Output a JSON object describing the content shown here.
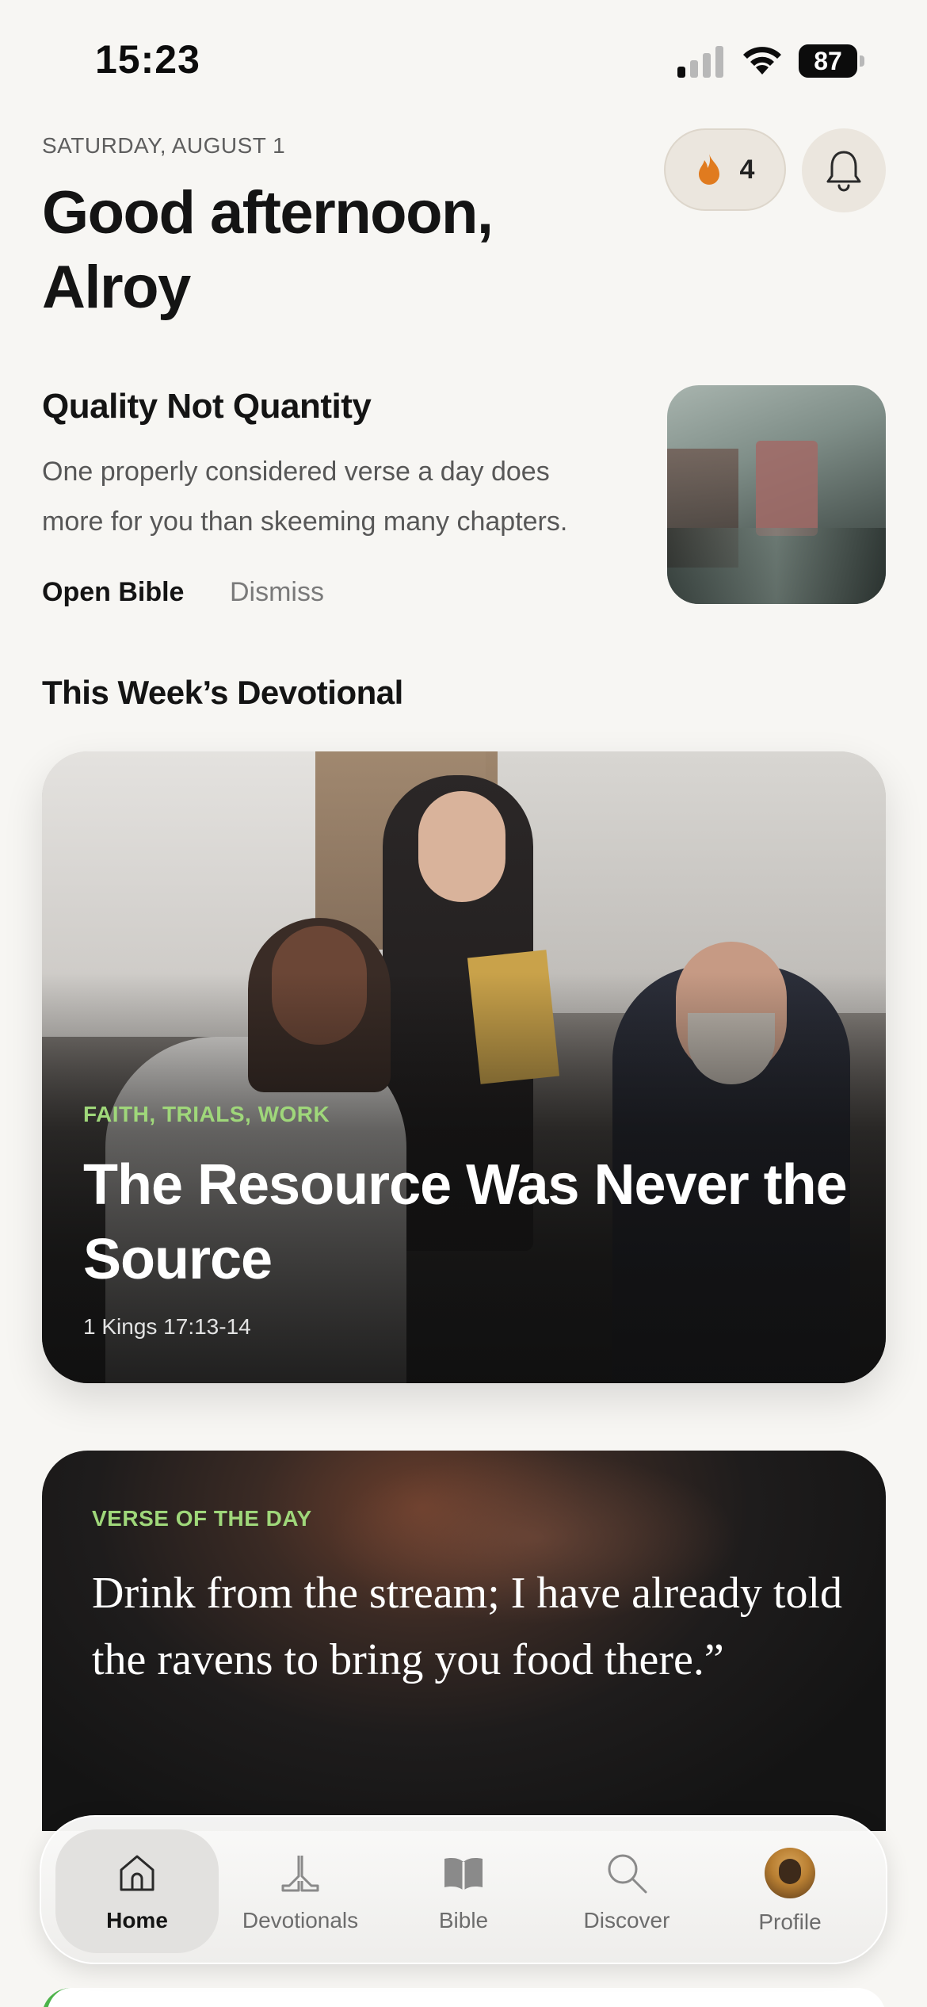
{
  "status_bar": {
    "time": "15:23",
    "battery": "87"
  },
  "header": {
    "date": "SATURDAY, AUGUST 1",
    "greeting": "Good afternoon, Alroy",
    "streak_count": "4",
    "streak_icon": "flame-icon",
    "notification_icon": "bell-icon"
  },
  "tip": {
    "title": "Quality Not Quantity",
    "body": "One properly considered verse a day does more for you than skeeming many chapters.",
    "open_label": "Open Bible",
    "dismiss_label": "Dismiss"
  },
  "devotional_section": {
    "title": "This Week’s Devotional",
    "card": {
      "tags": "FAITH, TRIALS, WORK",
      "title": "The Resource Was Never the Source",
      "reference": "1 Kings 17:13-14"
    }
  },
  "verse_of_day": {
    "label": "VERSE OF THE DAY",
    "text": "Drink from the stream; I have already told the ravens to bring you food there.”"
  },
  "tabbar": {
    "tabs": [
      {
        "label": "Home",
        "icon": "home-icon",
        "active": true
      },
      {
        "label": "Devotionals",
        "icon": "praying-hands-icon",
        "active": false
      },
      {
        "label": "Bible",
        "icon": "book-icon",
        "active": false
      },
      {
        "label": "Discover",
        "icon": "search-icon",
        "active": false
      },
      {
        "label": "Profile",
        "icon": "avatar",
        "active": false
      }
    ]
  },
  "colors": {
    "background": "#f7f6f3",
    "accent_green": "#9fd77a",
    "flame": "#e07b1f"
  }
}
